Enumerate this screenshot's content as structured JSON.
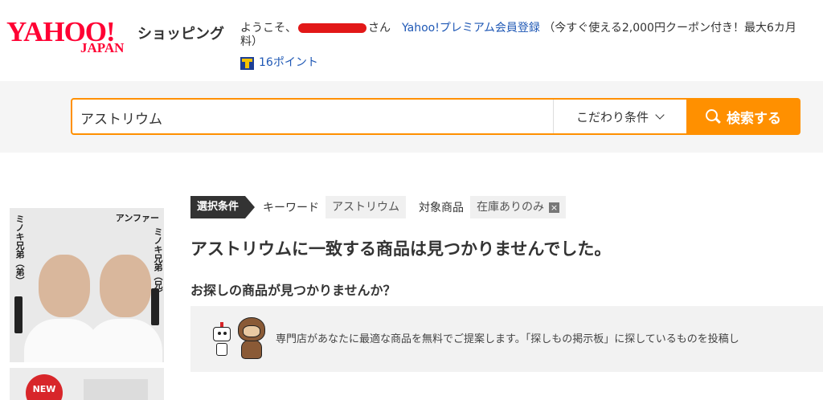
{
  "header": {
    "logo_main": "YAHOO!",
    "logo_sub": "JAPAN",
    "shopping_title": "ショッピング",
    "welcome_prefix": "ようこそ、",
    "welcome_suffix": "さん",
    "premium_link": "Yahoo!プレミアム会員登録",
    "premium_note": "（今すぐ使える2,000円クーポン付き！最大6カ月",
    "premium_note_line2": "料）",
    "points": "16ポイント"
  },
  "search": {
    "query": "アストリウム",
    "conditions_label": "こだわり条件",
    "button_label": "検索する"
  },
  "ad": {
    "brand": "アンファー",
    "left_caption": "ミノキ兄弟（弟）",
    "right_caption": "ミノキ兄弟（兄）",
    "new_badge": "NEW"
  },
  "conditions": {
    "tag": "選択条件",
    "keyword_label": "キーワード",
    "keyword_value": "アストリウム",
    "target_label": "対象商品",
    "target_value": "在庫ありのみ",
    "remove_icon": "×"
  },
  "results": {
    "not_found": "アストリウムに一致する商品は見つかりませんでした。",
    "ask": "お探しの商品が見つかりませんか？",
    "board_text": "専門店があなたに最適な商品を無料でご提案します。「探しもの掲示板」に探しているものを投稿し"
  },
  "colors": {
    "brand_red": "#ff0033",
    "accent_orange": "#ff9000",
    "link_blue": "#1f58b5"
  }
}
